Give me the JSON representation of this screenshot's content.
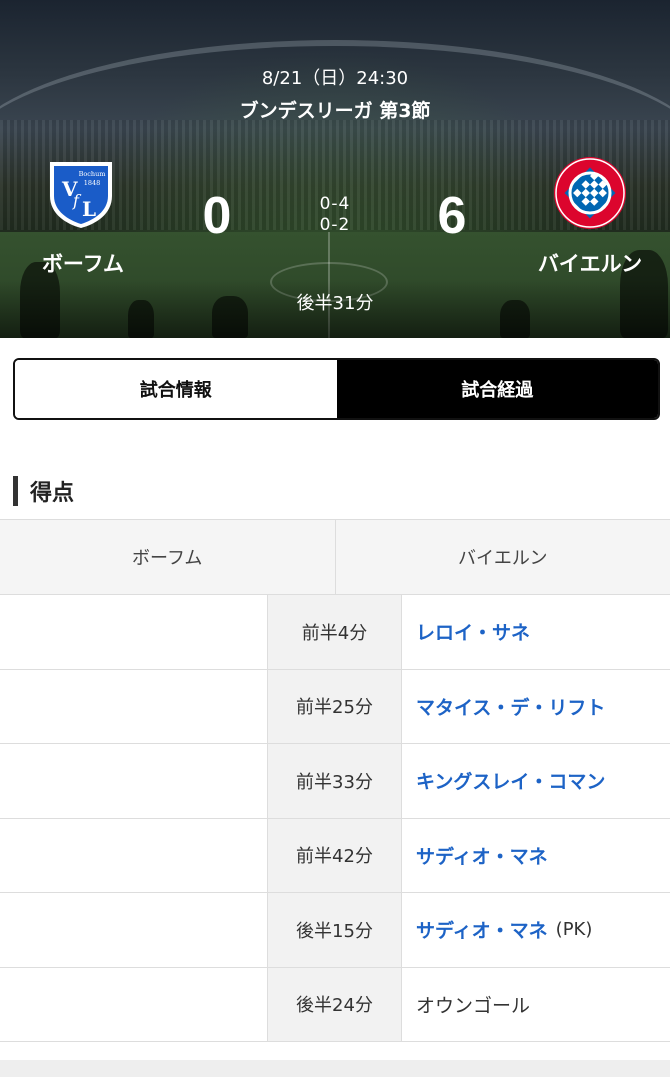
{
  "match": {
    "datetime": "8/21（日）24:30",
    "competition": "ブンデスリーガ 第3節",
    "status": "後半31分",
    "home": {
      "name": "ボーフム",
      "score": "0",
      "logo_icon": "vfl-bochum-crest-icon",
      "color": "#1a5cc8"
    },
    "away": {
      "name": "バイエルン",
      "score": "6",
      "logo_icon": "fc-bayern-crest-icon",
      "color": "#dc052d"
    },
    "halves": {
      "first": "0-4",
      "second": "0-2"
    }
  },
  "tabs": [
    {
      "label": "試合情報",
      "active": false
    },
    {
      "label": "試合経過",
      "active": true
    }
  ],
  "goals_section": {
    "title": "得点",
    "home_header": "ボーフム",
    "away_header": "バイエルン",
    "rows": [
      {
        "time": "前半4分",
        "away_player": "レロイ・サネ",
        "note": ""
      },
      {
        "time": "前半25分",
        "away_player": "マタイス・デ・リフト",
        "note": ""
      },
      {
        "time": "前半33分",
        "away_player": "キングスレイ・コマン",
        "note": ""
      },
      {
        "time": "前半42分",
        "away_player": "サディオ・マネ",
        "note": ""
      },
      {
        "time": "後半15分",
        "away_player": "サディオ・マネ",
        "note": "(PK)"
      },
      {
        "time": "後半24分",
        "away_player": "",
        "note": "",
        "own_goal": "オウンゴール"
      }
    ]
  },
  "colors": {
    "link": "#1d63c6",
    "active_tab": "#000000"
  }
}
